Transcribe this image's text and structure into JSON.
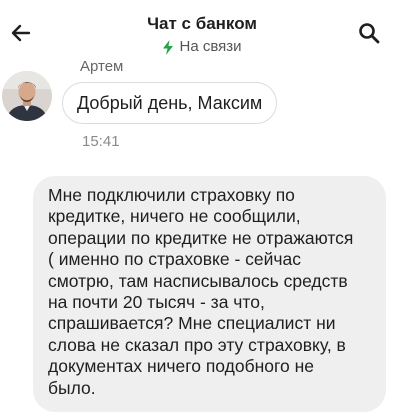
{
  "header": {
    "title": "Чат с банком",
    "status": "На связи",
    "back_icon": "arrow-left-icon",
    "search_icon": "search-icon",
    "status_icon": "lightning-bolt-icon",
    "status_color": "#22a447"
  },
  "chat": {
    "incoming": {
      "sender": "Артем",
      "text": "Добрый день, Максим",
      "time": "15:41"
    },
    "outgoing": {
      "text": "Мне подключили страховку по\nкредитке, ничего не сообщили,\nоперации по кредитке не отражаются\n( именно по страховке - сейчас\nсмотрю, там насписывалось средств\nна почти 20 тысяч - за что,\nспрашивается? Мне специалист ни\nслова не сказал про эту страховку, в\nдокументах ничего подобного не\nбыло."
    }
  }
}
